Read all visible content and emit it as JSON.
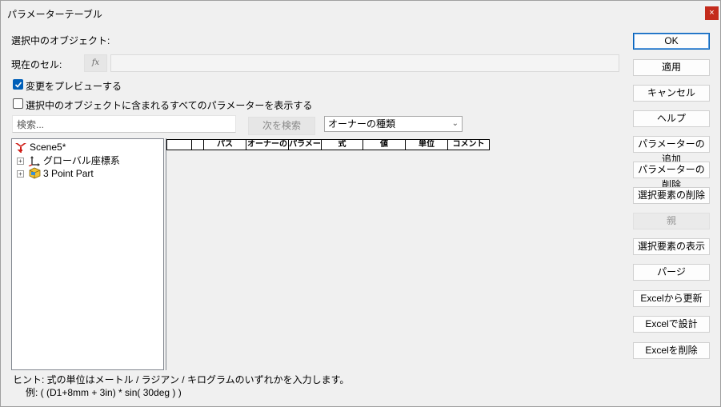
{
  "window": {
    "title": "パラメーターテーブル",
    "close_glyph": "×"
  },
  "labels": {
    "selected_object": "選択中のオブジェクト:",
    "current_cell": "現在のセル:",
    "fx": "fx"
  },
  "options": {
    "preview_changes": {
      "label": "変更をプレビューする",
      "checked": true
    },
    "show_all_params": {
      "label": "選択中のオブジェクトに含まれるすべてのパラメーターを表示する",
      "checked": false
    }
  },
  "search": {
    "placeholder": "検索...",
    "next_button": "次を検索"
  },
  "owner_type_select": {
    "value": "オーナーの種類"
  },
  "tree": {
    "items": [
      {
        "label": "Scene5*",
        "icon": "scene-icon"
      },
      {
        "label": "グローバル座標系",
        "icon": "coordinate-system-icon"
      },
      {
        "label": "3 Point Part",
        "icon": "part-icon"
      }
    ]
  },
  "grid": {
    "columns": [
      "",
      "",
      "パス",
      "オーナーの",
      "パラメー",
      "式",
      "値",
      "単位",
      "コメント"
    ]
  },
  "buttons": {
    "ok": "OK",
    "apply": "適用",
    "cancel": "キャンセル",
    "help": "ヘルプ",
    "add_param": "パラメーターの追加",
    "delete_param": "パラメーターの削除",
    "delete_selected": "選択要素の削除",
    "parent": "親",
    "show_selected": "選択要素の表示",
    "purge": "パージ",
    "update_from_excel": "Excelから更新",
    "design_in_excel": "Excelで設計",
    "delete_excel": "Excelを削除"
  },
  "hint": {
    "line1": "ヒント: 式の単位はメートル / ラジアン / キログラムのいずれかを入力します。",
    "line2": "例: ( (D1+8mm + 3in) * sin( 30deg ) )"
  },
  "colors": {
    "accent": "#005fb8",
    "close": "#c42b1c"
  }
}
